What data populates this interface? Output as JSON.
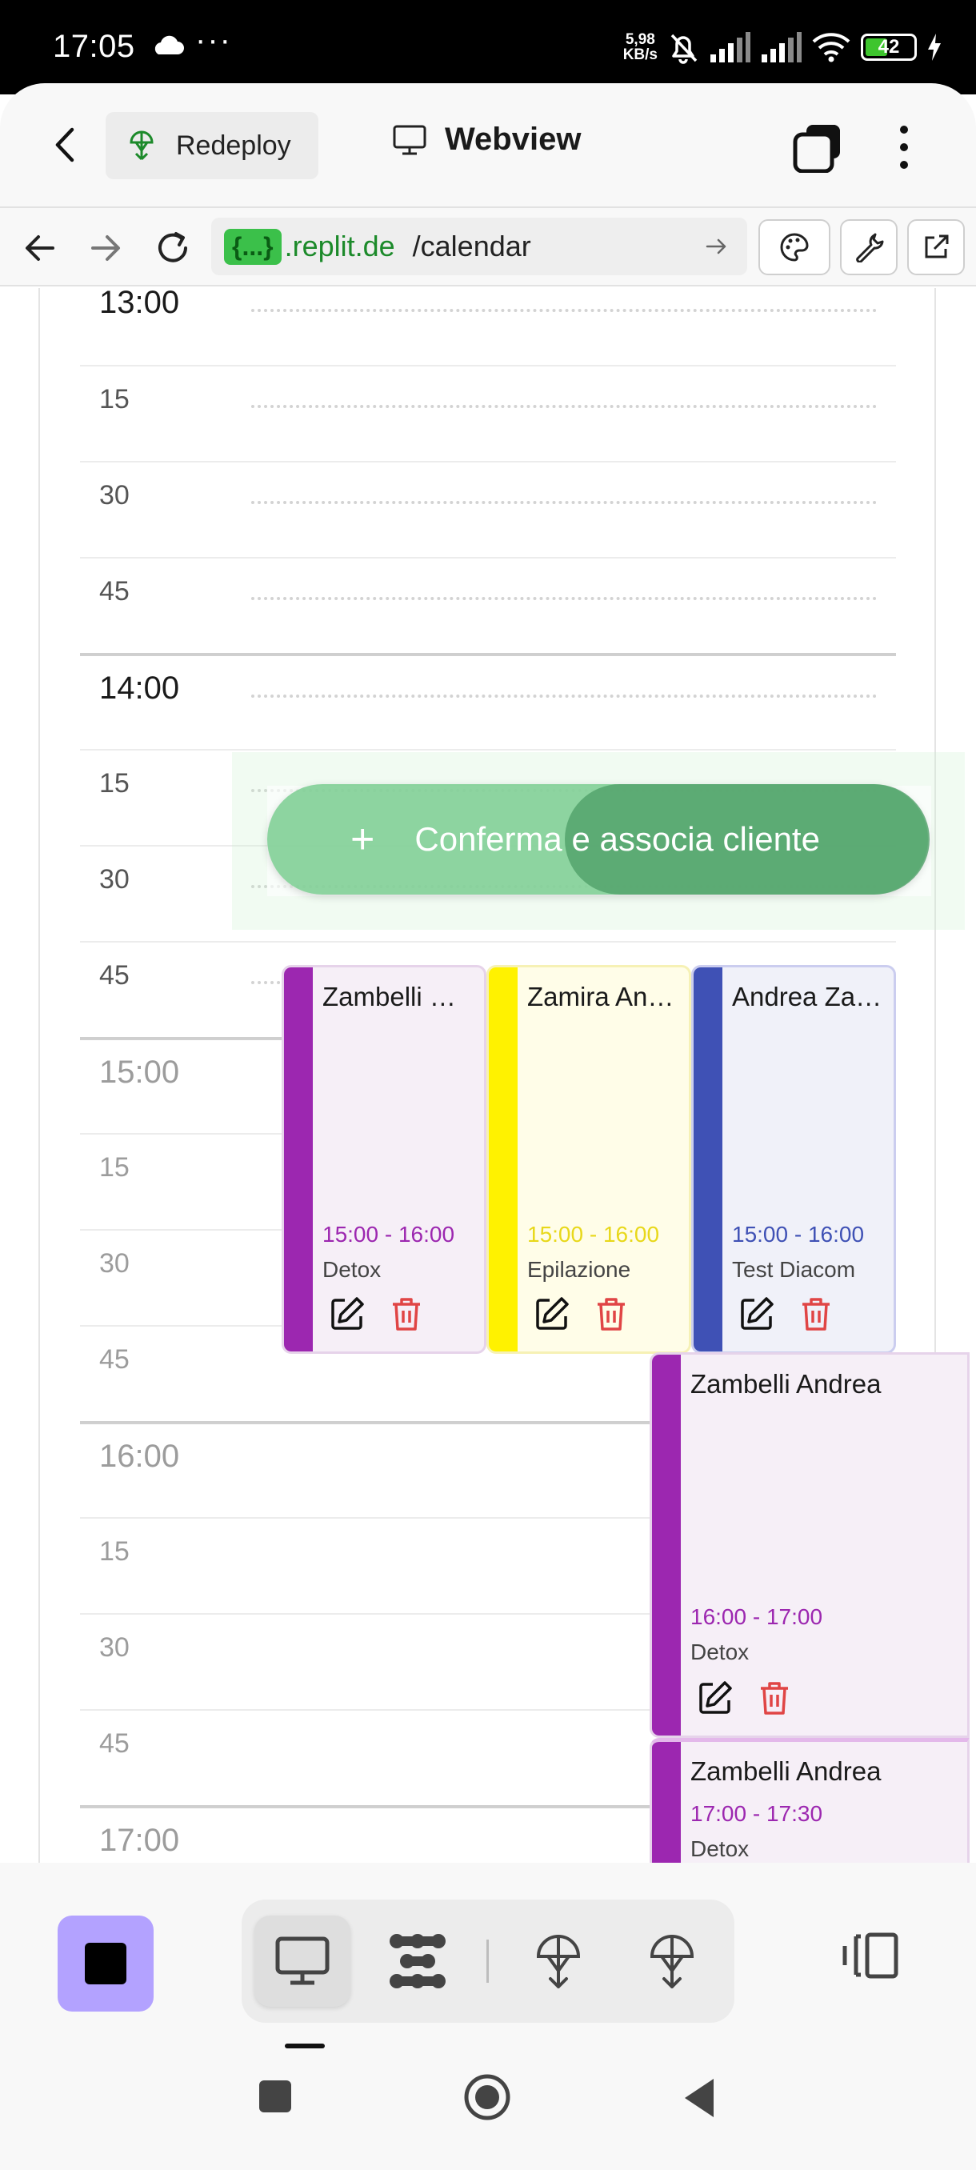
{
  "status_bar": {
    "time": "17:05",
    "dots": "···",
    "speed_value": "5,98",
    "speed_unit": "KB/s",
    "battery": "42"
  },
  "app_bar": {
    "redeploy_label": "Redeploy",
    "title": "Webview"
  },
  "url_bar": {
    "badge": "{...}",
    "host": ".replit.de",
    "path": "/calendar"
  },
  "calendar": {
    "slots": [
      {
        "label": "13:00",
        "kind": "hour",
        "dim": false
      },
      {
        "label": "15",
        "kind": "quarter",
        "dim": false
      },
      {
        "label": "30",
        "kind": "quarter",
        "dim": false
      },
      {
        "label": "45",
        "kind": "quarter",
        "dim": false
      },
      {
        "label": "14:00",
        "kind": "hour",
        "dim": false
      },
      {
        "label": "15",
        "kind": "quarter",
        "dim": false
      },
      {
        "label": "30",
        "kind": "quarter",
        "dim": false
      },
      {
        "label": "45",
        "kind": "quarter",
        "dim": false
      },
      {
        "label": "15:00",
        "kind": "hour",
        "dim": true
      },
      {
        "label": "15",
        "kind": "quarter",
        "dim": true
      },
      {
        "label": "30",
        "kind": "quarter",
        "dim": true
      },
      {
        "label": "45",
        "kind": "quarter",
        "dim": true
      },
      {
        "label": "16:00",
        "kind": "hour",
        "dim": true
      },
      {
        "label": "15",
        "kind": "quarter",
        "dim": true
      },
      {
        "label": "30",
        "kind": "quarter",
        "dim": true
      },
      {
        "label": "45",
        "kind": "quarter",
        "dim": true
      },
      {
        "label": "17:00",
        "kind": "hour",
        "dim": true
      }
    ],
    "confirm_button": {
      "plus": "+",
      "label": "Conferma e associa cliente"
    },
    "events": [
      {
        "title": "Zambelli …",
        "time": "15:00 - 16:00",
        "service": "Detox",
        "color": "purple"
      },
      {
        "title": "Zamira An…",
        "time": "15:00 - 16:00",
        "service": "Epilazione",
        "color": "yellow"
      },
      {
        "title": "Andrea Za…",
        "time": "15:00 - 16:00",
        "service": "Test Diacom",
        "color": "blue"
      },
      {
        "title": "Zambelli Andrea",
        "time": "16:00 - 17:00",
        "service": "Detox",
        "color": "purple"
      },
      {
        "title": "Zambelli Andrea",
        "time": "17:00 - 17:30",
        "service": "Detox",
        "color": "purple"
      }
    ]
  },
  "colors": {
    "purple": "#9c27b0",
    "yellow": "#fff200",
    "blue": "#3f51b5",
    "confirm_green": "#6ec887",
    "stop_button": "#b3a2ff"
  },
  "icons": {
    "back": "back-chevron-icon",
    "redeploy": "deploy-icon",
    "webview": "monitor-icon",
    "tabs": "tabs-icon",
    "more": "more-vertical-icon",
    "edit": "edit-icon",
    "delete": "trash-icon"
  }
}
